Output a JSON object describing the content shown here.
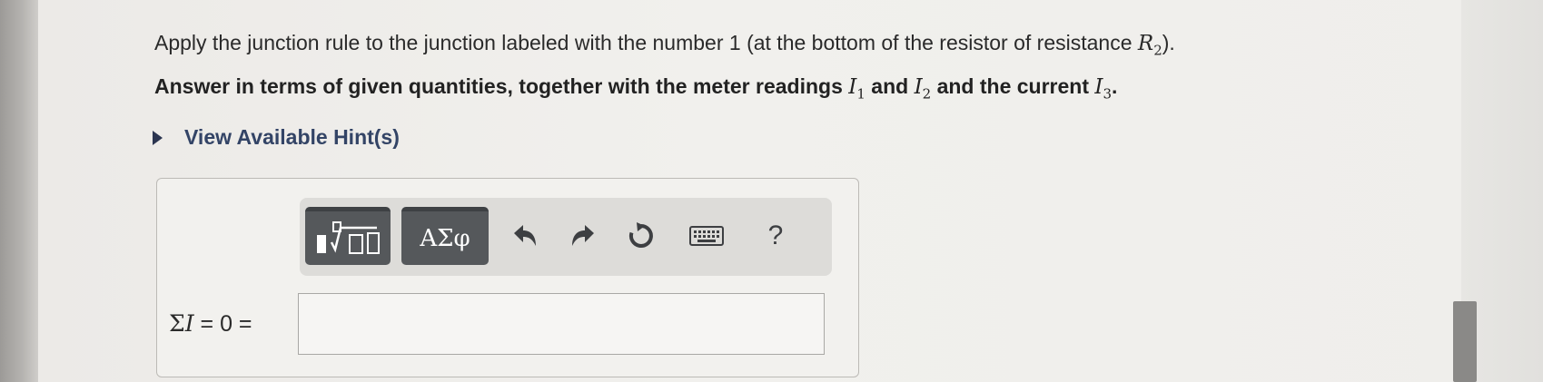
{
  "question": {
    "line1_prefix": "Apply the junction rule to the junction labeled with the number 1 (at the bottom of the resistor of resistance ",
    "line1_var": "R",
    "line1_var_sub": "2",
    "line1_suffix": ").",
    "line2_prefix": "Answer in terms of given quantities, together with the meter readings ",
    "line2_var1": "I",
    "line2_var1_sub": "1",
    "line2_and": " and ",
    "line2_var2": "I",
    "line2_var2_sub": "2",
    "line2_mid": " and the current ",
    "line2_var3": "I",
    "line2_var3_sub": "3",
    "line2_suffix": "."
  },
  "hint": {
    "label": "View Available Hint(s)"
  },
  "toolbar": {
    "symbols_label": "ΑΣφ",
    "help_label": "?",
    "icons": [
      "templates-icon",
      "undo-icon",
      "redo-icon",
      "reset-icon",
      "keyboard-icon"
    ]
  },
  "equation": {
    "sum_symbol": "Σ",
    "var": "I",
    "rhs": " = 0 =",
    "input_value": ""
  }
}
